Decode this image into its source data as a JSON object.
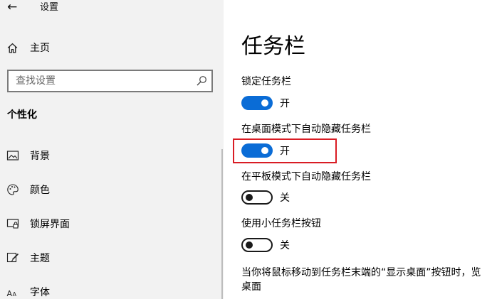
{
  "window": {
    "title": "设置"
  },
  "nav": {
    "back_icon": "arrow-left-icon",
    "home_label": "主页",
    "search_placeholder": "查找设置",
    "section_title": "个性化",
    "items": [
      {
        "label": "背景",
        "icon": "picture-icon"
      },
      {
        "label": "颜色",
        "icon": "palette-icon"
      },
      {
        "label": "锁屏界面",
        "icon": "lock-screen-icon"
      },
      {
        "label": "主题",
        "icon": "theme-brush-icon"
      },
      {
        "label": "字体",
        "icon": "font-icon"
      }
    ]
  },
  "main": {
    "title": "任务栏",
    "settings": [
      {
        "label": "锁定任务栏",
        "state": "开",
        "on": true
      },
      {
        "label": "在桌面模式下自动隐藏任务栏",
        "state": "开",
        "on": true
      },
      {
        "label": "在平板模式下自动隐藏任务栏",
        "state": "关",
        "on": false
      },
      {
        "label": "使用小任务栏按钮",
        "state": "关",
        "on": false
      }
    ],
    "peek_description": "当你将鼠标移动到任务栏末端的“显示桌面”按钮时，览桌面"
  },
  "colors": {
    "accent": "#0a6cd6",
    "highlight": "#d91c24",
    "nav_bg": "#f2f2f2"
  }
}
